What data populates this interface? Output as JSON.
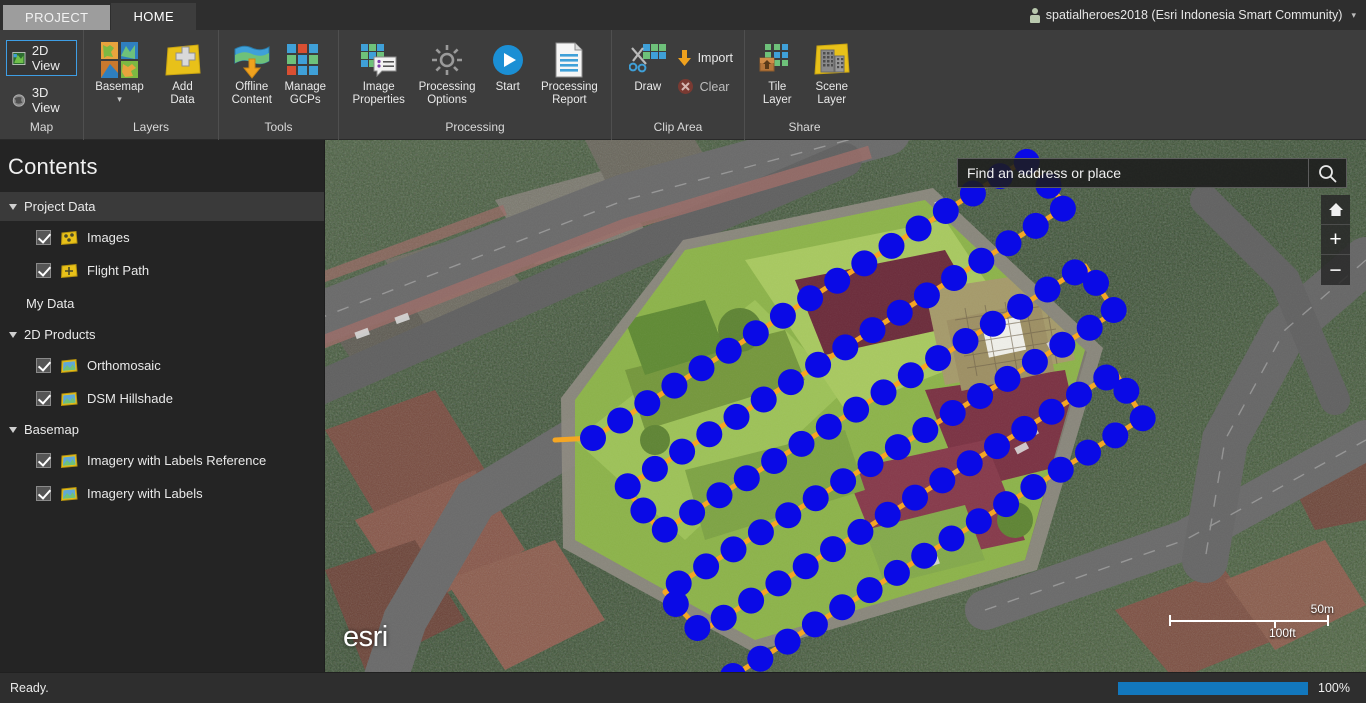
{
  "window": {
    "tabs": [
      {
        "id": "project",
        "label": "PROJECT"
      },
      {
        "id": "home",
        "label": "HOME"
      }
    ],
    "account": {
      "icon": "person-icon",
      "label": "spatialheroes2018 (Esri Indonesia Smart Community)",
      "caret": "▾"
    }
  },
  "ribbon": {
    "groups": [
      {
        "name": "map",
        "label": "Map",
        "buttons": [
          {
            "id": "2d-view",
            "label": "2D View",
            "icon": "map-2d-icon",
            "selected": true
          },
          {
            "id": "3d-view",
            "label": "3D View",
            "icon": "globe-3d-icon",
            "selected": false
          }
        ]
      },
      {
        "name": "layers",
        "label": "Layers",
        "buttons": [
          {
            "id": "basemap",
            "label": "Basemap",
            "icon": "basemap-tiles-icon",
            "has_dropdown": true,
            "caret": "▾"
          },
          {
            "id": "add-data",
            "label": "Add\nData",
            "icon": "add-data-icon"
          }
        ]
      },
      {
        "name": "tools",
        "label": "Tools",
        "buttons": [
          {
            "id": "offline-content",
            "label": "Offline\nContent",
            "icon": "offline-content-icon"
          },
          {
            "id": "manage-gcps",
            "label": "Manage\nGCPs",
            "icon": "manage-gcps-icon"
          }
        ]
      },
      {
        "name": "processing",
        "label": "Processing",
        "buttons": [
          {
            "id": "image-properties",
            "label": "Image\nProperties",
            "icon": "image-properties-icon"
          },
          {
            "id": "processing-options",
            "label": "Processing\nOptions",
            "icon": "gear-icon"
          },
          {
            "id": "start",
            "label": "Start",
            "icon": "play-icon"
          },
          {
            "id": "processing-report",
            "label": "Processing\nReport",
            "icon": "report-document-icon"
          }
        ]
      },
      {
        "name": "clip-area",
        "label": "Clip Area",
        "buttons": [
          {
            "id": "draw",
            "label": "Draw",
            "icon": "scissors-grid-icon"
          }
        ],
        "small_buttons": [
          {
            "id": "import",
            "label": "Import",
            "icon": "down-arrow-icon",
            "disabled": false
          },
          {
            "id": "clear",
            "label": "Clear",
            "icon": "clear-x-icon",
            "disabled": true
          }
        ]
      },
      {
        "name": "share",
        "label": "Share",
        "buttons": [
          {
            "id": "tile-layer",
            "label": "Tile\nLayer",
            "icon": "tile-layer-icon"
          },
          {
            "id": "scene-layer",
            "label": "Scene\nLayer",
            "icon": "scene-layer-icon"
          }
        ]
      }
    ]
  },
  "contents": {
    "title": "Contents",
    "tree": [
      {
        "type": "group",
        "id": "project-data",
        "label": "Project Data",
        "expanded": true,
        "highlighted": true
      },
      {
        "type": "layer",
        "id": "images",
        "label": "Images",
        "checked": true,
        "icon": "vector-layer-icon"
      },
      {
        "type": "layer",
        "id": "flight-path",
        "label": "Flight Path",
        "checked": true,
        "icon": "flight-path-layer-icon"
      },
      {
        "type": "plain",
        "id": "my-data",
        "label": "My Data"
      },
      {
        "type": "group",
        "id": "2d-products",
        "label": "2D Products",
        "expanded": true,
        "highlighted": false
      },
      {
        "type": "layer",
        "id": "orthomosaic",
        "label": "Orthomosaic",
        "checked": true,
        "icon": "raster-layer-icon"
      },
      {
        "type": "layer",
        "id": "dsm-hillshade",
        "label": "DSM Hillshade",
        "checked": true,
        "icon": "raster-layer-icon"
      },
      {
        "type": "group",
        "id": "basemap",
        "label": "Basemap",
        "expanded": true,
        "highlighted": false
      },
      {
        "type": "layer",
        "id": "imagery-with-labels-reference",
        "label": "Imagery with Labels Reference",
        "checked": true,
        "icon": "raster-layer-icon"
      },
      {
        "type": "layer",
        "id": "imagery-with-labels",
        "label": "Imagery with Labels",
        "checked": true,
        "icon": "raster-layer-icon"
      }
    ]
  },
  "map": {
    "search": {
      "placeholder": "Find an address or place",
      "value": "",
      "icon": "search-icon"
    },
    "nav": [
      {
        "id": "home",
        "icon": "home-icon",
        "label": ""
      },
      {
        "id": "zoom-in",
        "icon": "plus-icon",
        "label": "+"
      },
      {
        "id": "zoom-out",
        "icon": "minus-icon",
        "label": "−"
      }
    ],
    "attribution": "esri",
    "scalebar": {
      "metric": "50m",
      "imperial": "100ft"
    },
    "overlay": {
      "image_point_color": "#0A0AE6",
      "flight_path_color": "#F5A623",
      "image_point_count": 104
    }
  },
  "status": {
    "message": "Ready.",
    "progress_percent": 100,
    "progress_label": "100%",
    "progress_color": "#1277bc"
  }
}
